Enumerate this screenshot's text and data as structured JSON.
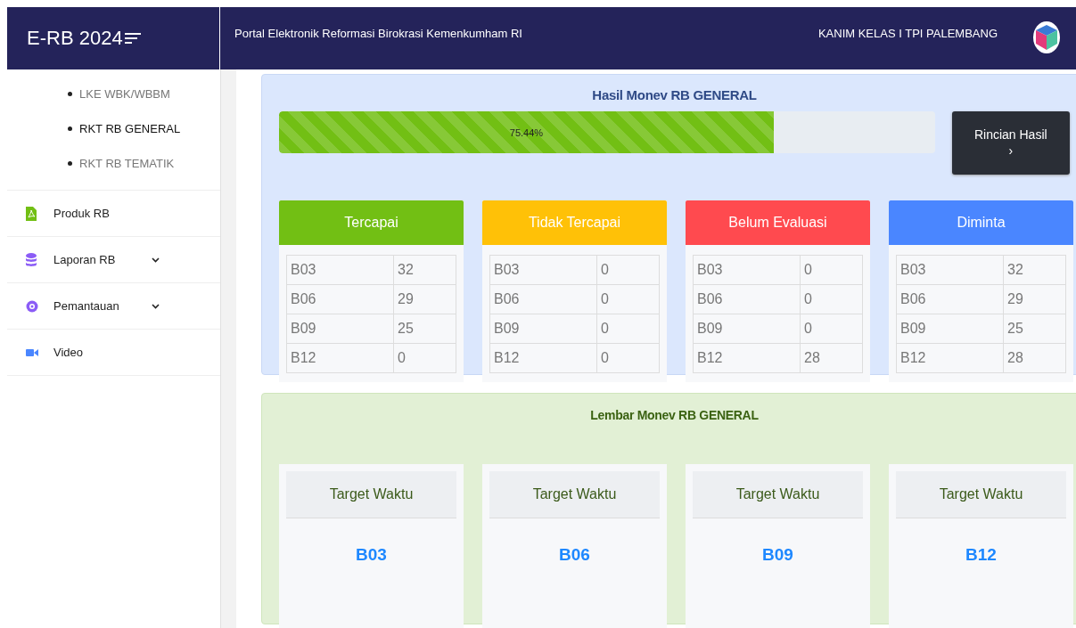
{
  "header": {
    "brand": "E-RB 2024",
    "title": "Portal Elektronik Reformasi Birokrasi Kemenkumham RI",
    "office": "KANIM KELAS I TPI PALEMBANG"
  },
  "sidebar": {
    "subitems": [
      {
        "label": "LKE WBK/WBBM",
        "selected": false
      },
      {
        "label": "RKT RB GENERAL",
        "selected": true
      },
      {
        "label": "RKT RB TEMATIK",
        "selected": false
      }
    ],
    "items": [
      {
        "label": "Produk RB",
        "kind": "pdf",
        "expandable": false
      },
      {
        "label": "Laporan RB",
        "kind": "database",
        "expandable": true
      },
      {
        "label": "Pemantauan",
        "kind": "eye",
        "expandable": true
      },
      {
        "label": "Video",
        "kind": "video",
        "expandable": false
      }
    ]
  },
  "hasil": {
    "title": "Hasil Monev RB GENERAL",
    "progress": {
      "level": 0.7544,
      "reading": "75.44%"
    },
    "button": {
      "label": "Rincian Hasil",
      "icon": "›"
    },
    "cards": [
      {
        "title": "Tercapai",
        "color": "#72bf14",
        "rows": [
          [
            "B03",
            "32"
          ],
          [
            "B06",
            "29"
          ],
          [
            "B09",
            "25"
          ],
          [
            "B12",
            "0"
          ]
        ]
      },
      {
        "title": "Tidak Tercapai",
        "color": "#ffc107",
        "rows": [
          [
            "B03",
            "0"
          ],
          [
            "B06",
            "0"
          ],
          [
            "B09",
            "0"
          ],
          [
            "B12",
            "0"
          ]
        ]
      },
      {
        "title": "Belum Evaluasi",
        "color": "#ff4a4f",
        "rows": [
          [
            "B03",
            "0"
          ],
          [
            "B06",
            "0"
          ],
          [
            "B09",
            "0"
          ],
          [
            "B12",
            "28"
          ]
        ]
      },
      {
        "title": "Diminta",
        "color": "#4a86ff",
        "rows": [
          [
            "B03",
            "32"
          ],
          [
            "B06",
            "29"
          ],
          [
            "B09",
            "25"
          ],
          [
            "B12",
            "28"
          ]
        ]
      }
    ]
  },
  "lembar": {
    "title": "Lembar Monev RB GENERAL",
    "cards": [
      {
        "heading": "Target Waktu",
        "value": "B03"
      },
      {
        "heading": "Target Waktu",
        "value": "B06"
      },
      {
        "heading": "Target Waktu",
        "value": "B09"
      },
      {
        "heading": "Target Waktu",
        "value": "B12"
      }
    ]
  }
}
